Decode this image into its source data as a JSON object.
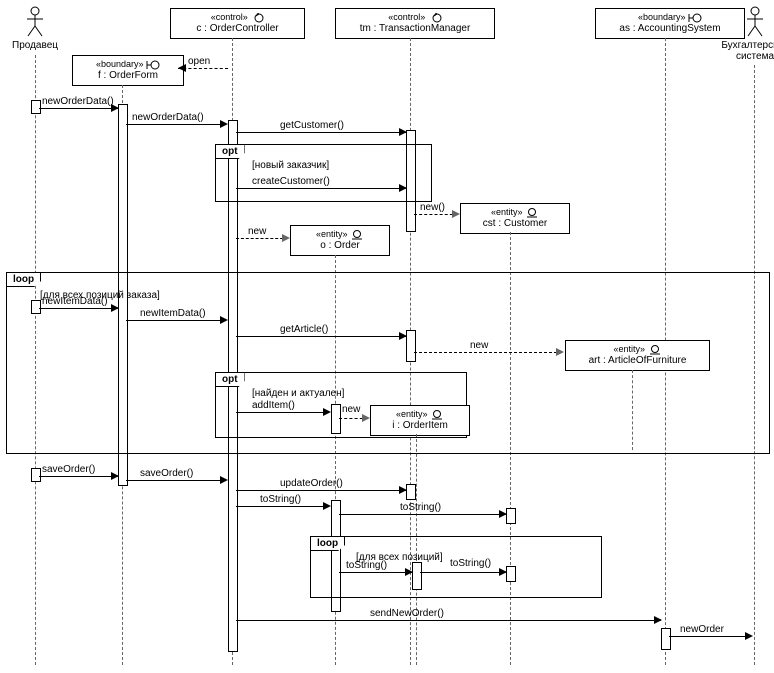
{
  "actors": {
    "seller": "Продавец",
    "accSystem": "Бухгалтерская\nсистема"
  },
  "lifelines": {
    "orderController": {
      "stereo": "«control»",
      "name": "c : OrderController"
    },
    "transactionMgr": {
      "stereo": "«control»",
      "name": "tm : TransactionManager"
    },
    "accountingSys": {
      "stereo": "«boundary»",
      "name": "as : AccountingSystem"
    },
    "orderForm": {
      "stereo": "«boundary»",
      "name": "f : OrderForm"
    },
    "order": {
      "stereo": "«entity»",
      "name": "o : Order"
    },
    "customer": {
      "stereo": "«entity»",
      "name": "cst : Customer"
    },
    "article": {
      "stereo": "«entity»",
      "name": "art : ArticleOfFurniture"
    },
    "orderItem": {
      "stereo": "«entity»",
      "name": "i : OrderItem"
    }
  },
  "messages": {
    "open": "open",
    "newOrderData1": "newOrderData()",
    "newOrderData2": "newOrderData()",
    "getCustomer": "getCustomer()",
    "guardNewCust": "[новый заказчик]",
    "createCustomer": "createCustomer()",
    "new1": "new",
    "new2": "new()",
    "guardLoop1": "[для всех позиций заказа]",
    "newItemData1": "newItemData()",
    "newItemData2": "newItemData()",
    "getArticle": "getArticle()",
    "new3": "new",
    "guardFound": "[найден и актуален]",
    "addItem": "addItem()",
    "new4": "new",
    "saveOrder1": "saveOrder()",
    "saveOrder2": "saveOrder()",
    "updateOrder": "updateOrder()",
    "toString1": "toString()",
    "toString2": "toString()",
    "guardLoop2": "[для всех позиций]",
    "toString3": "toString()",
    "toString4": "toString()",
    "sendNewOrder": "sendNewOrder()",
    "newOrder": "newOrder"
  },
  "frags": {
    "opt": "opt",
    "loop": "loop"
  }
}
